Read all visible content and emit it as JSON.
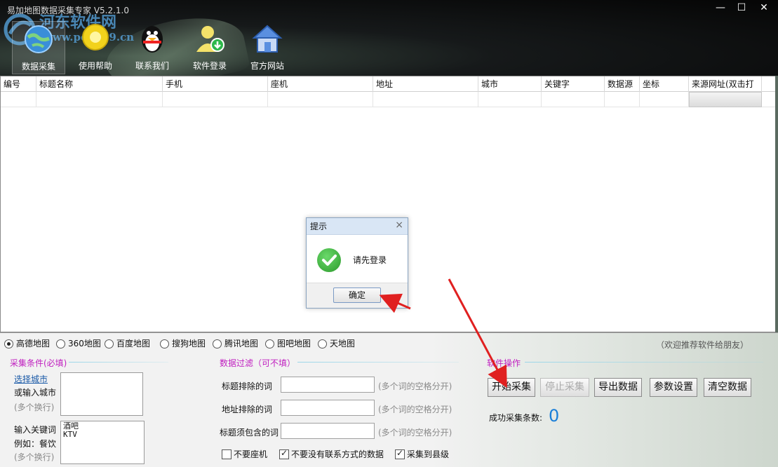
{
  "window": {
    "title": "易加地图数据采集专家 V5.2.1.0",
    "controls": {
      "minimize": "—",
      "maximize": "☐",
      "close": "✕"
    }
  },
  "watermark": {
    "text": "河东软件网",
    "url": "www.pc0359.cn"
  },
  "toolbar": {
    "items": [
      {
        "label": "数据采集",
        "icon": "globe-icon"
      },
      {
        "label": "使用帮助",
        "icon": "help-bulb-icon"
      },
      {
        "label": "联系我们",
        "icon": "qq-penguin-icon"
      },
      {
        "label": "软件登录",
        "icon": "user-login-icon"
      },
      {
        "label": "官方网站",
        "icon": "home-icon"
      }
    ]
  },
  "table": {
    "columns": [
      "编号",
      "标题名称",
      "手机",
      "座机",
      "地址",
      "城市",
      "关键字",
      "数据源",
      "坐标",
      "来源网址(双击打"
    ]
  },
  "dialog": {
    "title": "提示",
    "close": "×",
    "message": "请先登录",
    "ok": "确定"
  },
  "sources": {
    "options": [
      "高德地图",
      "360地图",
      "百度地图",
      "搜狗地图",
      "腾讯地图",
      "图吧地图",
      "天地图"
    ],
    "selected": "高德地图",
    "recommend": "（欢迎推荐软件给朋友）"
  },
  "conditions": {
    "title": "采集条件(必填)",
    "select_city_link": "选择城市",
    "or_input_city": "或输入城市",
    "multi_line": "(多个换行)",
    "input_keyword": "输入关键词",
    "example": "例如：餐饮",
    "multi_line2": "(多个换行)",
    "keyword_lines": [
      "酒吧",
      "KTV"
    ]
  },
  "filter": {
    "title": "数据过滤（可不填）",
    "exclude_title_label": "标题排除的词",
    "exclude_address_label": "地址排除的词",
    "include_title_label": "标题须包含的词",
    "hint": "(多个词的空格分开)",
    "checkboxes": [
      {
        "label": "不要座机",
        "checked": false
      },
      {
        "label": "不要没有联系方式的数据",
        "checked": true
      },
      {
        "label": "采集到县级",
        "checked": true
      }
    ]
  },
  "operations": {
    "title": "软件操作",
    "start": "开始采集",
    "stop": "停止采集",
    "export": "导出数据",
    "settings": "参数设置",
    "clear": "清空数据",
    "count_label": "成功采集条数:",
    "count_value": "0"
  },
  "colors": {
    "section_title": "#c020c0",
    "count": "#1a7fd8",
    "arrow": "#e02020"
  }
}
